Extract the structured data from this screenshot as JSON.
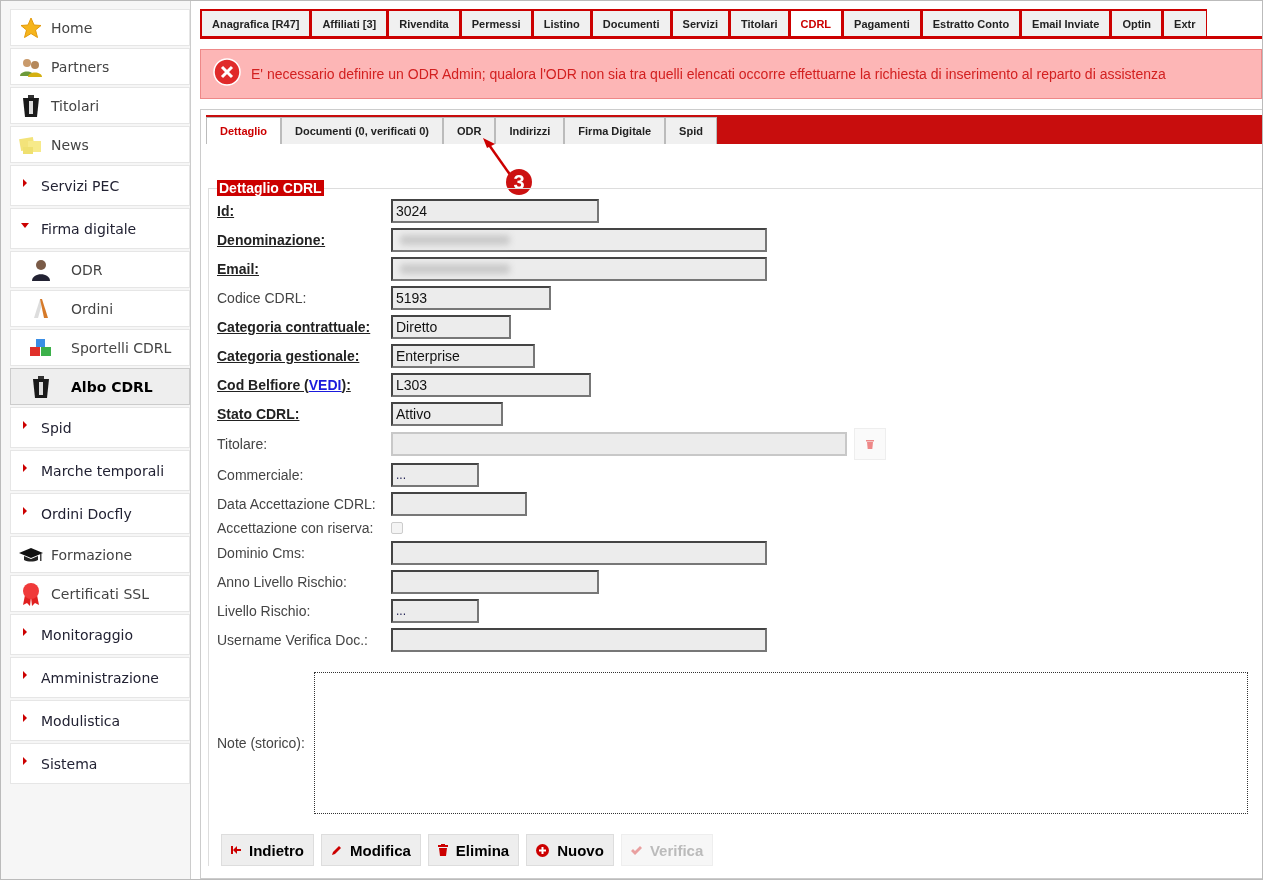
{
  "sidebar": {
    "items": [
      {
        "kind": "icon",
        "label": "Home",
        "selected": false
      },
      {
        "kind": "icon",
        "label": "Partners",
        "selected": false
      },
      {
        "kind": "icon",
        "label": "Titolari",
        "selected": false
      },
      {
        "kind": "icon",
        "label": "News",
        "selected": false
      },
      {
        "kind": "section",
        "label": "Servizi PEC",
        "expanded": false
      },
      {
        "kind": "section",
        "label": "Firma digitale",
        "expanded": true,
        "children": [
          {
            "kind": "icon",
            "label": "ODR",
            "selected": false
          },
          {
            "kind": "icon",
            "label": "Ordini",
            "selected": false
          },
          {
            "kind": "icon",
            "label": "Sportelli CDRL",
            "selected": false
          },
          {
            "kind": "icon",
            "label": "Albo CDRL",
            "selected": true
          }
        ]
      },
      {
        "kind": "section",
        "label": "Spid",
        "expanded": false
      },
      {
        "kind": "section",
        "label": "Marche temporali",
        "expanded": false
      },
      {
        "kind": "section",
        "label": "Ordini Docfly",
        "expanded": false
      },
      {
        "kind": "icon",
        "label": "Formazione",
        "selected": false
      },
      {
        "kind": "icon",
        "label": "Certificati SSL",
        "selected": false
      },
      {
        "kind": "section",
        "label": "Monitoraggio",
        "expanded": false
      },
      {
        "kind": "section",
        "label": "Amministrazione",
        "expanded": false
      },
      {
        "kind": "section",
        "label": "Modulistica",
        "expanded": false
      },
      {
        "kind": "section",
        "label": "Sistema",
        "expanded": false
      }
    ]
  },
  "tabs": [
    {
      "label": "Anagrafica [R47]",
      "selected": false
    },
    {
      "label": "Affiliati [3]",
      "selected": false
    },
    {
      "label": "Rivendita",
      "selected": false
    },
    {
      "label": "Permessi",
      "selected": false
    },
    {
      "label": "Listino",
      "selected": false
    },
    {
      "label": "Documenti",
      "selected": false
    },
    {
      "label": "Servizi",
      "selected": false
    },
    {
      "label": "Titolari",
      "selected": false
    },
    {
      "label": "CDRL",
      "selected": true
    },
    {
      "label": "Pagamenti",
      "selected": false
    },
    {
      "label": "Estratto Conto",
      "selected": false
    },
    {
      "label": "Email Inviate",
      "selected": false
    },
    {
      "label": "Optin",
      "selected": false
    },
    {
      "label": "Extr",
      "selected": false
    }
  ],
  "error": {
    "message": "E' necessario definire un ODR Admin; qualora l'ODR non sia tra quelli elencati occorre effettuarne la richiesta di inserimento al reparto di assistenza"
  },
  "subtabs": [
    {
      "label": "Dettaglio",
      "selected": true
    },
    {
      "label": "Documenti (0, verificati 0)",
      "selected": false
    },
    {
      "label": "ODR",
      "selected": false
    },
    {
      "label": "Indirizzi",
      "selected": false
    },
    {
      "label": "Firma Digitale",
      "selected": false
    },
    {
      "label": "Spid",
      "selected": false
    }
  ],
  "callout": {
    "label": "3"
  },
  "form": {
    "legend": "Dettaglio CDRL",
    "fields": [
      {
        "kind": "text",
        "label": "Id:",
        "required": true,
        "value": "3024"
      },
      {
        "kind": "text",
        "label": "Denominazione:",
        "required": true,
        "redacted": true
      },
      {
        "kind": "text",
        "label": "Email:",
        "required": true,
        "redacted": true
      },
      {
        "kind": "text",
        "label": "Codice CDRL:",
        "required": false,
        "value": "5193"
      },
      {
        "kind": "text",
        "label": "Categoria contrattuale:",
        "required": true,
        "value": "Diretto"
      },
      {
        "kind": "text",
        "label": "Categoria gestionale:",
        "required": true,
        "value": "Enterprise"
      },
      {
        "kind": "text",
        "label": "Cod Belfiore (",
        "link": "VEDI",
        "label_end": "):",
        "required": true,
        "value": "L303"
      },
      {
        "kind": "text",
        "label": "Stato CDRL:",
        "required": true,
        "value": "Attivo"
      },
      {
        "kind": "lookup",
        "label": "Titolare:",
        "required": false,
        "disabled": true
      },
      {
        "kind": "select",
        "label": "Commerciale:",
        "required": false,
        "value": "..."
      },
      {
        "kind": "text",
        "label": "Data Accettazione CDRL:",
        "required": false
      },
      {
        "kind": "checkbox",
        "label": "Accettazione con riserva:",
        "required": false,
        "checked": false
      },
      {
        "kind": "text",
        "label": "Dominio Cms:",
        "required": false
      },
      {
        "kind": "text",
        "label": "Anno Livello Rischio:",
        "required": false
      },
      {
        "kind": "select",
        "label": "Livello Rischio:",
        "required": false,
        "value": "..."
      },
      {
        "kind": "text",
        "label": "Username Verifica Doc.:",
        "required": false
      },
      {
        "kind": "textarea",
        "label": "Note (storico):",
        "required": false
      }
    ]
  },
  "buttons": [
    {
      "label": "Indietro",
      "disabled": false
    },
    {
      "label": "Modifica",
      "disabled": false
    },
    {
      "label": "Elimina",
      "disabled": false
    },
    {
      "label": "Nuovo",
      "disabled": false
    },
    {
      "label": "Verifica",
      "disabled": true
    }
  ]
}
